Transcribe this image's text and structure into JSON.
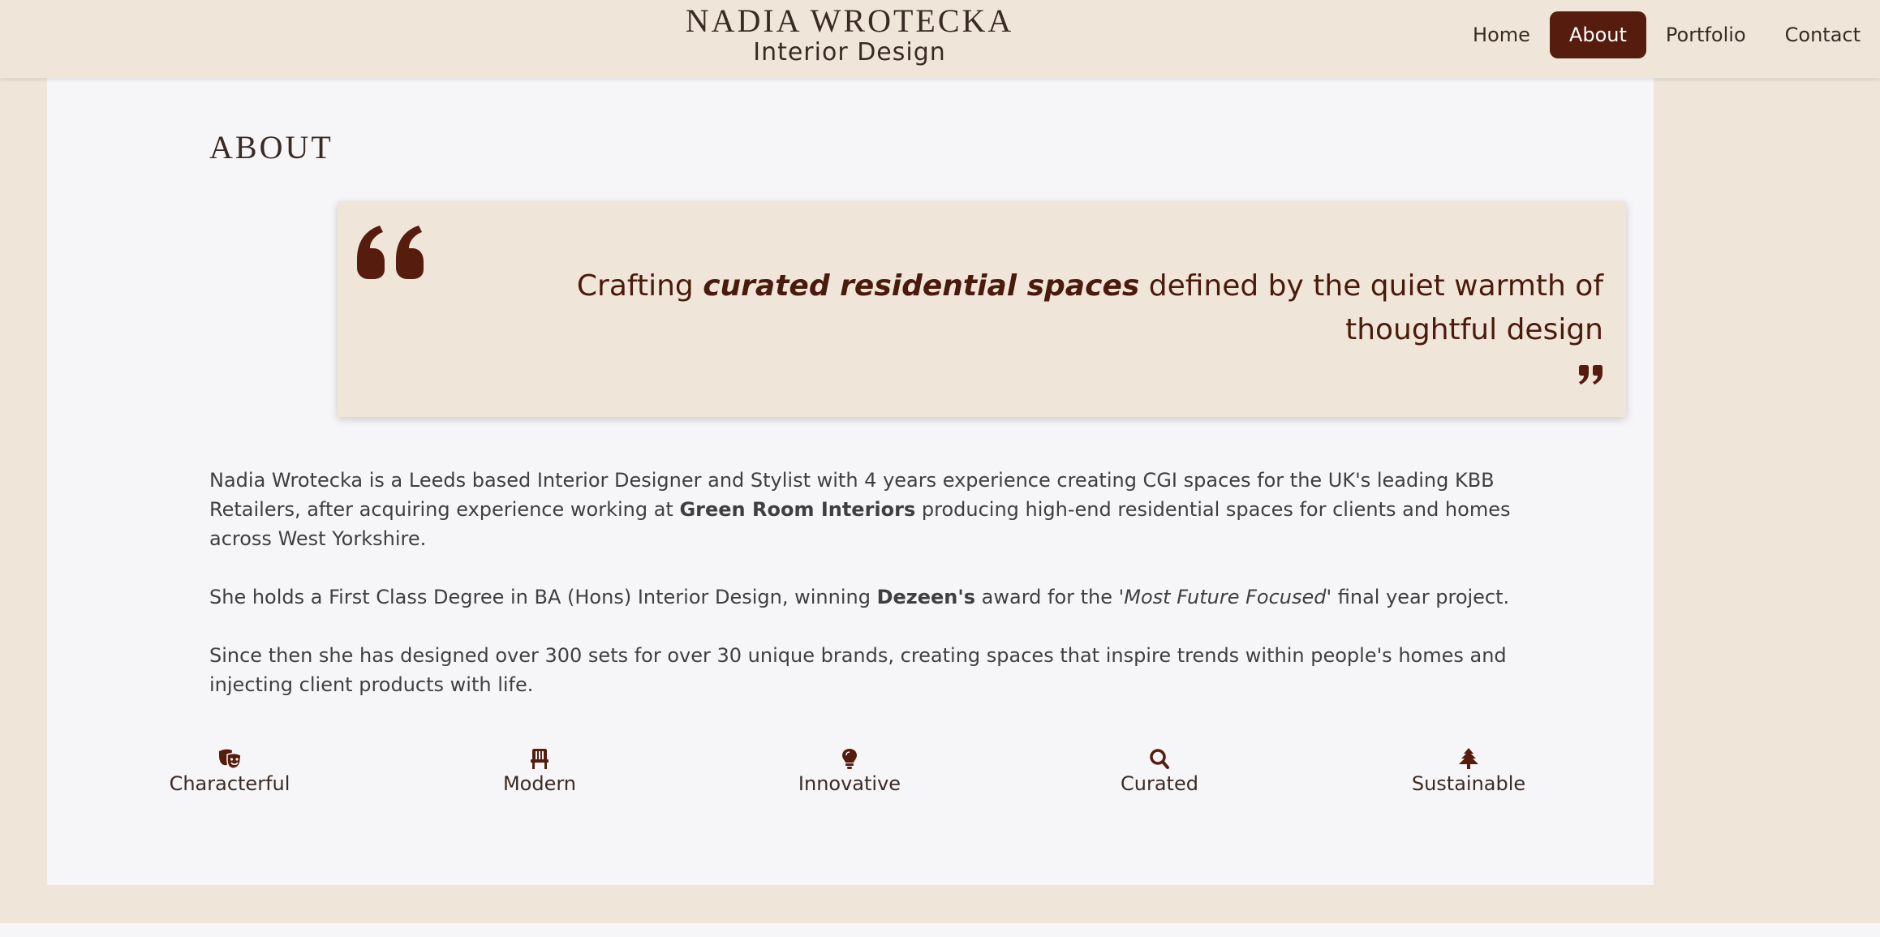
{
  "header": {
    "brand_name": "NADIA WROTECKA",
    "brand_subtitle": "Interior Design",
    "nav": [
      {
        "label": "Home",
        "active": false
      },
      {
        "label": "About",
        "active": true
      },
      {
        "label": "Portfolio",
        "active": false
      },
      {
        "label": "Contact",
        "active": false
      }
    ]
  },
  "about": {
    "title": "ABOUT",
    "quote": {
      "pre": "Crafting ",
      "emphasis": "curated residential spaces",
      "post": " defined by the quiet warmth of thoughtful design"
    },
    "paragraphs": [
      {
        "a": "Nadia Wrotecka is a Leeds based Interior Designer and Stylist with 4 years experience creating CGI spaces for the UK's leading KBB Retailers, after acquiring experience working at ",
        "b": "Green Room Interiors",
        "c": " producing high-end residential spaces for clients and homes across West Yorkshire."
      },
      {
        "a": "She holds a First Class Degree in BA (Hons) Interior Design, winning ",
        "b": "Dezeen's",
        "c": " award for the ",
        "d": "'Most Future Focused'",
        "e": " final year project."
      },
      {
        "a": "Since then she has designed over 300 sets for over 30 unique brands, creating spaces that inspire trends within people's homes and injecting client products with life."
      }
    ],
    "values": [
      {
        "label": "Characterful",
        "icon": "theater-masks-icon"
      },
      {
        "label": "Modern",
        "icon": "chair-icon"
      },
      {
        "label": "Innovative",
        "icon": "lightbulb-icon"
      },
      {
        "label": "Curated",
        "icon": "search-icon"
      },
      {
        "label": "Sustainable",
        "icon": "tree-icon"
      }
    ]
  },
  "colors": {
    "background": "#efe6d9",
    "panel": "#f6f6f8",
    "accent": "#561d0f",
    "text": "#3a2a24"
  }
}
